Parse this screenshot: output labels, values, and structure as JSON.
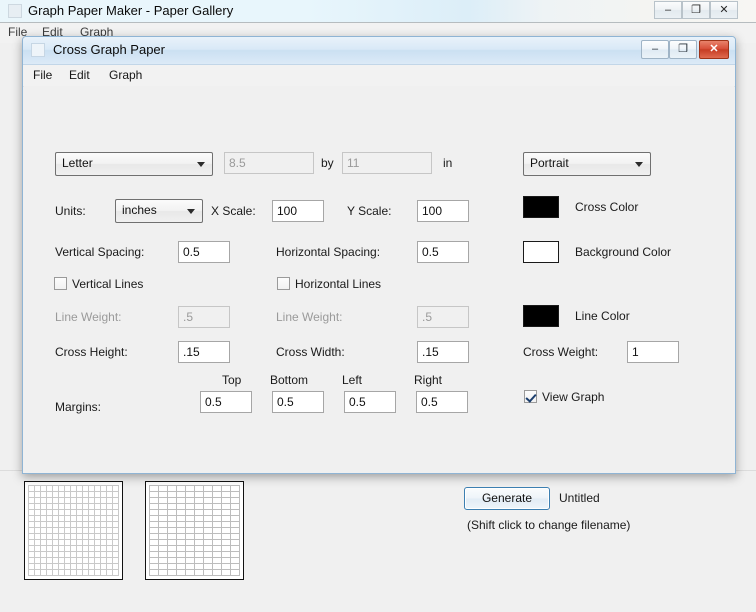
{
  "background_window": {
    "title": "Graph Paper Maker - Paper Gallery",
    "icon": "app-icon",
    "menus": [
      {
        "label": "File",
        "x": 8
      },
      {
        "label": "Edit",
        "x": 42
      },
      {
        "label": "Graph",
        "x": 80
      }
    ],
    "controls": {
      "minimize": "–",
      "maximize": "❐",
      "close": "✕"
    },
    "gallery": {
      "thumbnails": [
        {
          "name": "grid-paper-thumbnail",
          "pattern": "grid"
        },
        {
          "name": "brick-paper-thumbnail",
          "pattern": "brick"
        }
      ]
    }
  },
  "dialog": {
    "title": "Cross Graph Paper",
    "icon": "dialog-icon",
    "menus": [
      {
        "label": "File",
        "x": 10
      },
      {
        "label": "Edit",
        "x": 46
      },
      {
        "label": "Graph",
        "x": 86
      }
    ],
    "controls": {
      "minimize": "–",
      "maximize": "❐",
      "close": "✕"
    },
    "paper": {
      "size_selected": "Letter",
      "width_value": "8.5",
      "by_label": "by",
      "height_value": "11",
      "unit_label": "in",
      "orientation_selected": "Portrait"
    },
    "units": {
      "label": "Units:",
      "selected": "inches"
    },
    "scale": {
      "x_label": "X Scale:",
      "x_value": "100",
      "y_label": "Y Scale:",
      "y_value": "100"
    },
    "spacing": {
      "vertical_label": "Vertical Spacing:",
      "vertical_value": "0.5",
      "horizontal_label": "Horizontal Spacing:",
      "horizontal_value": "0.5"
    },
    "lines": {
      "vertical_lines_label": "Vertical Lines",
      "vertical_lines_checked": false,
      "horizontal_lines_label": "Horizontal Lines",
      "horizontal_lines_checked": false
    },
    "line_weight": {
      "left_label": "Line Weight:",
      "left_value": ".5",
      "right_label": "Line Weight:",
      "right_value": ".5"
    },
    "cross": {
      "height_label": "Cross Height:",
      "height_value": ".15",
      "width_label": "Cross Width:",
      "width_value": ".15",
      "weight_label": "Cross Weight:",
      "weight_value": "1"
    },
    "margins": {
      "label": "Margins:",
      "top_label": "Top",
      "top_value": "0.5",
      "bottom_label": "Bottom",
      "bottom_value": "0.5",
      "left_label": "Left",
      "left_value": "0.5",
      "right_label": "Right",
      "right_value": "0.5"
    },
    "colors": {
      "cross_label": "Cross Color",
      "cross_value": "#000000",
      "background_label": "Background Color",
      "background_value": "#ffffff",
      "line_label": "Line Color",
      "line_value": "#000000"
    },
    "view_graph": {
      "label": "View Graph",
      "checked": true
    },
    "actions": {
      "generate_label": "Generate",
      "filename": "Untitled",
      "hint": "(Shift click to change filename)"
    }
  }
}
